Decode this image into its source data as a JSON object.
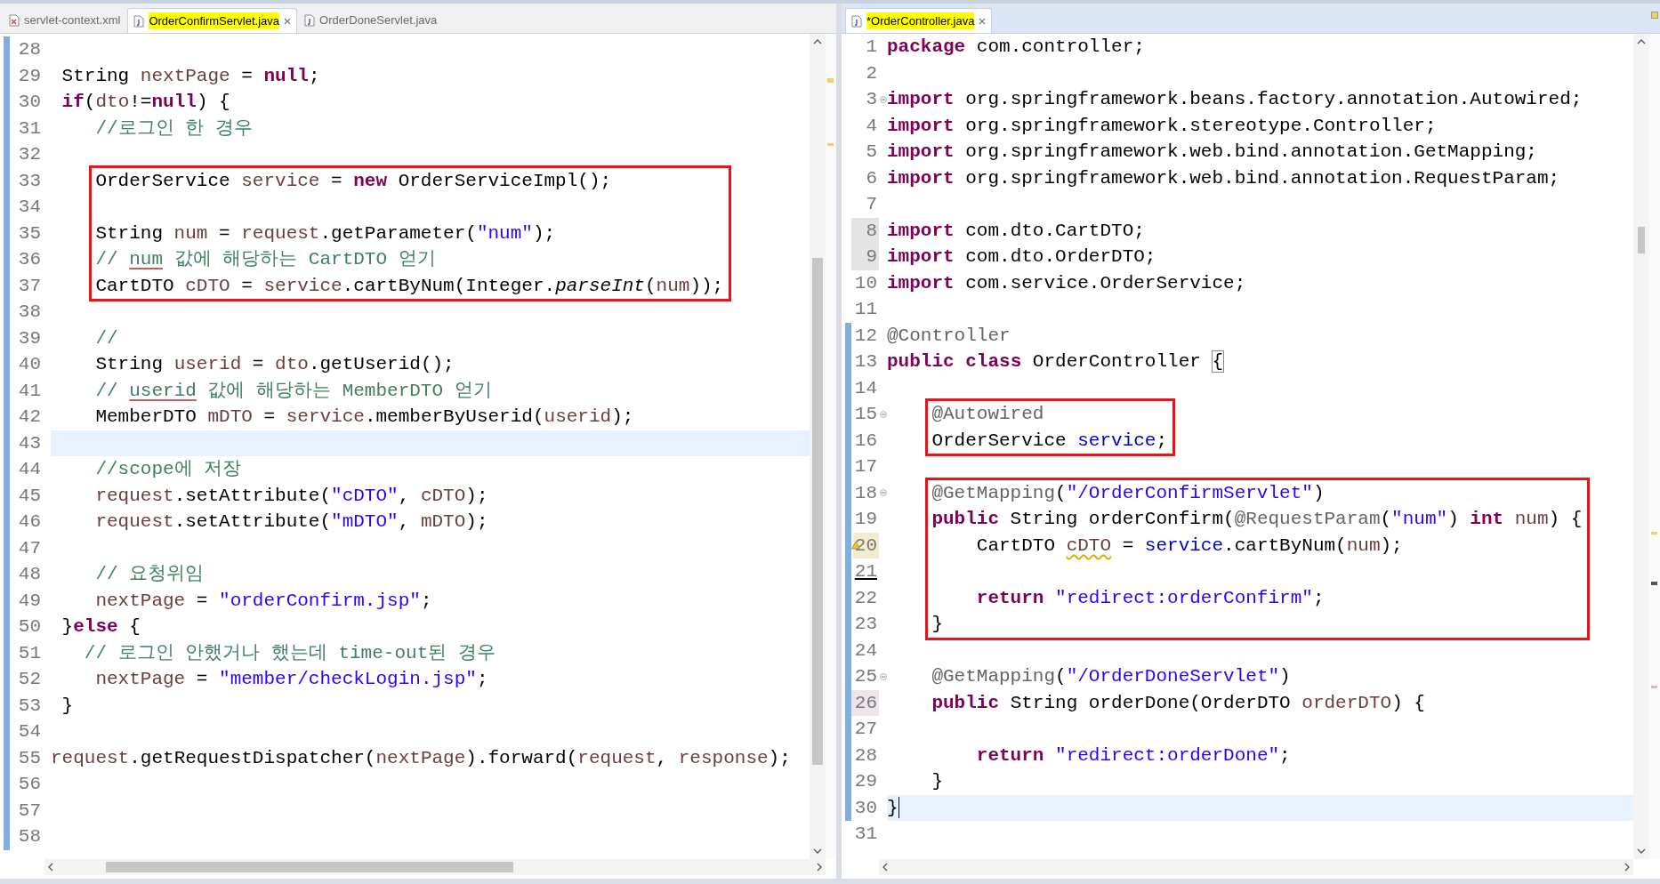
{
  "editors": [
    {
      "tabs": [
        {
          "label": "servlet-context.xml",
          "kind": "xml",
          "selected": false,
          "highlighted": false,
          "closable": false
        },
        {
          "label": "OrderConfirmServlet.java",
          "kind": "java",
          "selected": true,
          "highlighted": true,
          "closable": true
        },
        {
          "label": "OrderDoneServlet.java",
          "kind": "java",
          "selected": false,
          "highlighted": false,
          "closable": false
        }
      ],
      "lines": [
        {
          "n": "28",
          "current": false,
          "boxed": false,
          "diff": true
        },
        {
          "n": "29",
          "tokens": [
            {
              "kind": "plain",
              "text": " String "
            },
            {
              "kind": "local",
              "text": "nextPage"
            },
            {
              "kind": "plain",
              "text": " = "
            },
            {
              "kind": "keyword",
              "text": "null"
            },
            {
              "kind": "plain",
              "text": ";"
            }
          ],
          "current": false,
          "boxed": false,
          "diff": true
        },
        {
          "n": "30",
          "tokens": [
            {
              "kind": "keyword",
              "text": " if"
            },
            {
              "kind": "plain",
              "text": "("
            },
            {
              "kind": "local",
              "text": "dto"
            },
            {
              "kind": "plain",
              "text": "!="
            },
            {
              "kind": "keyword",
              "text": "null"
            },
            {
              "kind": "plain",
              "text": ") {"
            }
          ],
          "current": false,
          "boxed": false,
          "diff": true
        },
        {
          "n": "31",
          "tokens": [
            {
              "kind": "comment",
              "text": "    //로그인 한 경우"
            }
          ],
          "current": false,
          "boxed": false,
          "diff": true
        },
        {
          "n": "32",
          "current": false,
          "boxed": false,
          "diff": true
        },
        {
          "n": "33",
          "tokens": [
            {
              "kind": "plain",
              "text": "    OrderService "
            },
            {
              "kind": "local",
              "text": "service"
            },
            {
              "kind": "plain",
              "text": " = "
            },
            {
              "kind": "keyword",
              "text": "new"
            },
            {
              "kind": "plain",
              "text": " OrderServiceImpl();"
            }
          ],
          "current": false,
          "boxed": true,
          "diff": true
        },
        {
          "n": "34",
          "current": false,
          "boxed": true,
          "diff": true
        },
        {
          "n": "35",
          "tokens": [
            {
              "kind": "plain",
              "text": "    String "
            },
            {
              "kind": "local",
              "text": "num"
            },
            {
              "kind": "plain",
              "text": " = "
            },
            {
              "kind": "local",
              "text": "request"
            },
            {
              "kind": "plain",
              "text": ".getParameter("
            },
            {
              "kind": "string",
              "text": "\"num\""
            },
            {
              "kind": "plain",
              "text": ");"
            }
          ],
          "current": false,
          "boxed": true,
          "diff": true
        },
        {
          "n": "36",
          "tokens": [
            {
              "kind": "comment",
              "text": "    // "
            },
            {
              "kind": "spelling",
              "text": "num"
            },
            {
              "kind": "comment",
              "text": " 값에 해당하는 CartDTO 얻기"
            }
          ],
          "current": false,
          "boxed": true,
          "diff": true
        },
        {
          "n": "37",
          "tokens": [
            {
              "kind": "plain",
              "text": "    CartDTO "
            },
            {
              "kind": "local",
              "text": "cDTO"
            },
            {
              "kind": "plain",
              "text": " = "
            },
            {
              "kind": "local",
              "text": "service"
            },
            {
              "kind": "plain",
              "text": ".cartByNum(Integer."
            },
            {
              "kind": "italic",
              "text": "parseInt"
            },
            {
              "kind": "plain",
              "text": "("
            },
            {
              "kind": "local",
              "text": "num"
            },
            {
              "kind": "plain",
              "text": "));"
            }
          ],
          "current": false,
          "boxed": true,
          "diff": true
        },
        {
          "n": "38",
          "current": false,
          "boxed": false,
          "diff": true
        },
        {
          "n": "39",
          "tokens": [
            {
              "kind": "comment",
              "text": "    //"
            }
          ],
          "current": false,
          "boxed": false,
          "diff": true
        },
        {
          "n": "40",
          "tokens": [
            {
              "kind": "plain",
              "text": "    String "
            },
            {
              "kind": "local",
              "text": "userid"
            },
            {
              "kind": "plain",
              "text": " = "
            },
            {
              "kind": "local",
              "text": "dto"
            },
            {
              "kind": "plain",
              "text": ".getUserid();"
            }
          ],
          "current": false,
          "boxed": false,
          "diff": true
        },
        {
          "n": "41",
          "tokens": [
            {
              "kind": "comment",
              "text": "    // "
            },
            {
              "kind": "spelling",
              "text": "userid"
            },
            {
              "kind": "comment",
              "text": " 값에 해당하는 MemberDTO 얻기"
            }
          ],
          "current": false,
          "boxed": false,
          "diff": true
        },
        {
          "n": "42",
          "tokens": [
            {
              "kind": "plain",
              "text": "    MemberDTO "
            },
            {
              "kind": "local",
              "text": "mDTO"
            },
            {
              "kind": "plain",
              "text": " = "
            },
            {
              "kind": "local",
              "text": "service"
            },
            {
              "kind": "plain",
              "text": ".memberByUserid("
            },
            {
              "kind": "local",
              "text": "userid"
            },
            {
              "kind": "plain",
              "text": ");"
            }
          ],
          "current": false,
          "boxed": false,
          "diff": true
        },
        {
          "n": "43",
          "current": true,
          "boxed": false,
          "diff": true
        },
        {
          "n": "44",
          "tokens": [
            {
              "kind": "comment",
              "text": "    //scope에 저장"
            }
          ],
          "current": false,
          "boxed": false,
          "diff": true
        },
        {
          "n": "45",
          "tokens": [
            {
              "kind": "local",
              "text": "    request"
            },
            {
              "kind": "plain",
              "text": ".setAttribute("
            },
            {
              "kind": "string",
              "text": "\"cDTO\""
            },
            {
              "kind": "plain",
              "text": ", "
            },
            {
              "kind": "local",
              "text": "cDTO"
            },
            {
              "kind": "plain",
              "text": ");"
            }
          ],
          "current": false,
          "boxed": false,
          "diff": true
        },
        {
          "n": "46",
          "tokens": [
            {
              "kind": "local",
              "text": "    request"
            },
            {
              "kind": "plain",
              "text": ".setAttribute("
            },
            {
              "kind": "string",
              "text": "\"mDTO\""
            },
            {
              "kind": "plain",
              "text": ", "
            },
            {
              "kind": "local",
              "text": "mDTO"
            },
            {
              "kind": "plain",
              "text": ");"
            }
          ],
          "current": false,
          "boxed": false,
          "diff": true
        },
        {
          "n": "47",
          "current": false,
          "boxed": false,
          "diff": true
        },
        {
          "n": "48",
          "tokens": [
            {
              "kind": "comment",
              "text": "    // 요청위임"
            }
          ],
          "current": false,
          "boxed": false,
          "diff": true
        },
        {
          "n": "49",
          "tokens": [
            {
              "kind": "local",
              "text": "    nextPage"
            },
            {
              "kind": "plain",
              "text": " = "
            },
            {
              "kind": "string",
              "text": "\"orderConfirm.jsp\""
            },
            {
              "kind": "plain",
              "text": ";"
            }
          ],
          "current": false,
          "boxed": false,
          "diff": true
        },
        {
          "n": "50",
          "tokens": [
            {
              "kind": "plain",
              "text": " }"
            },
            {
              "kind": "keyword",
              "text": "else"
            },
            {
              "kind": "plain",
              "text": " {"
            }
          ],
          "current": false,
          "boxed": false,
          "diff": true
        },
        {
          "n": "51",
          "tokens": [
            {
              "kind": "comment",
              "text": "   // 로그인 안했거나 했는데 time-out된 경우"
            }
          ],
          "current": false,
          "boxed": false,
          "diff": true
        },
        {
          "n": "52",
          "tokens": [
            {
              "kind": "local",
              "text": "    nextPage"
            },
            {
              "kind": "plain",
              "text": " = "
            },
            {
              "kind": "string",
              "text": "\"member/checkLogin.jsp\""
            },
            {
              "kind": "plain",
              "text": ";"
            }
          ],
          "current": false,
          "boxed": false,
          "diff": true
        },
        {
          "n": "53",
          "tokens": [
            {
              "kind": "plain",
              "text": " }"
            }
          ],
          "current": false,
          "boxed": false,
          "diff": true
        },
        {
          "n": "54",
          "current": false,
          "boxed": false,
          "diff": true
        },
        {
          "n": "55",
          "tokens": [
            {
              "kind": "local",
              "text": "request"
            },
            {
              "kind": "plain",
              "text": ".getRequestDispatcher("
            },
            {
              "kind": "local",
              "text": "nextPage"
            },
            {
              "kind": "plain",
              "text": ").forward("
            },
            {
              "kind": "local",
              "text": "request"
            },
            {
              "kind": "plain",
              "text": ", "
            },
            {
              "kind": "local",
              "text": "response"
            },
            {
              "kind": "plain",
              "text": ");"
            }
          ],
          "current": false,
          "boxed": false,
          "diff": true
        },
        {
          "n": "56",
          "current": false,
          "boxed": false,
          "diff": true
        },
        {
          "n": "57",
          "current": false,
          "boxed": false,
          "diff": true
        },
        {
          "n": "58",
          "current": false,
          "boxed": false,
          "diff": true
        }
      ]
    },
    {
      "tabs": [
        {
          "label": "*OrderController.java",
          "kind": "java",
          "selected": true,
          "highlighted": true,
          "closable": true
        }
      ],
      "lines": [
        {
          "n": "1",
          "tokens": [
            {
              "kind": "keyword",
              "text": "package"
            },
            {
              "kind": "plain",
              "text": " com.controller;"
            }
          ],
          "current": false,
          "boxed": false,
          "diff": false
        },
        {
          "n": "2",
          "current": false,
          "boxed": false,
          "diff": false
        },
        {
          "n": "3",
          "tokens": [
            {
              "kind": "keyword",
              "text": "import"
            },
            {
              "kind": "plain",
              "text": " org.springframework.beans.factory.annotation.Autowired;"
            }
          ],
          "current": false,
          "boxed": false,
          "diff": false,
          "kind": "fold"
        },
        {
          "n": "4",
          "tokens": [
            {
              "kind": "keyword",
              "text": "import"
            },
            {
              "kind": "plain",
              "text": " org.springframework.stereotype.Controller;"
            }
          ],
          "current": false,
          "boxed": false,
          "diff": false
        },
        {
          "n": "5",
          "tokens": [
            {
              "kind": "keyword",
              "text": "import"
            },
            {
              "kind": "plain",
              "text": " org.springframework.web.bind.annotation.GetMapping;"
            }
          ],
          "current": false,
          "boxed": false,
          "diff": false
        },
        {
          "n": "6",
          "tokens": [
            {
              "kind": "keyword",
              "text": "import"
            },
            {
              "kind": "plain",
              "text": " org.springframework.web.bind.annotation.RequestParam;"
            }
          ],
          "current": false,
          "boxed": false,
          "diff": false
        },
        {
          "n": "7",
          "current": false,
          "boxed": false,
          "diff": false
        },
        {
          "n": "8",
          "tokens": [
            {
              "kind": "keyword",
              "text": "import"
            },
            {
              "kind": "plain",
              "text": " com.dto.CartDTO;"
            }
          ],
          "current": false,
          "boxed": false,
          "diff": false,
          "kind": "changed"
        },
        {
          "n": "9",
          "tokens": [
            {
              "kind": "keyword",
              "text": "import"
            },
            {
              "kind": "plain",
              "text": " com.dto.OrderDTO;"
            }
          ],
          "current": false,
          "boxed": false,
          "diff": false,
          "kind": "changed"
        },
        {
          "n": "10",
          "tokens": [
            {
              "kind": "keyword",
              "text": "import"
            },
            {
              "kind": "plain",
              "text": " com.service.OrderService;"
            }
          ],
          "current": false,
          "boxed": false,
          "diff": false
        },
        {
          "n": "11",
          "current": false,
          "boxed": false,
          "diff": false
        },
        {
          "n": "12",
          "tokens": [
            {
              "kind": "annotation",
              "text": "@Controller"
            }
          ],
          "current": false,
          "boxed": false,
          "diff": true
        },
        {
          "n": "13",
          "tokens": [
            {
              "kind": "keyword",
              "text": "public"
            },
            {
              "kind": "keyword",
              "text": " class"
            },
            {
              "kind": "plain",
              "text": " OrderController "
            },
            {
              "kind": "bracket",
              "text": "{"
            }
          ],
          "current": false,
          "boxed": false,
          "diff": true
        },
        {
          "n": "14",
          "current": false,
          "boxed": false,
          "diff": true
        },
        {
          "n": "15",
          "tokens": [
            {
              "kind": "annotation",
              "text": "    @Autowired"
            }
          ],
          "current": false,
          "boxed": true,
          "diff": true,
          "kind": "fold"
        },
        {
          "n": "16",
          "tokens": [
            {
              "kind": "plain",
              "text": "    OrderService "
            },
            {
              "kind": "field",
              "text": "service"
            },
            {
              "kind": "plain",
              "text": ";"
            }
          ],
          "current": false,
          "boxed": true,
          "diff": true
        },
        {
          "n": "17",
          "current": false,
          "boxed": false,
          "diff": true
        },
        {
          "n": "18",
          "tokens": [
            {
              "kind": "annotation",
              "text": "    @GetMapping"
            },
            {
              "kind": "plain",
              "text": "("
            },
            {
              "kind": "string",
              "text": "\"/OrderConfirmServlet\""
            },
            {
              "kind": "plain",
              "text": ")"
            }
          ],
          "current": false,
          "boxed": true,
          "diff": true,
          "kind": "fold"
        },
        {
          "n": "19",
          "tokens": [
            {
              "kind": "keyword",
              "text": "    public"
            },
            {
              "kind": "plain",
              "text": " String orderConfirm("
            },
            {
              "kind": "annotation",
              "text": "@RequestParam"
            },
            {
              "kind": "plain",
              "text": "("
            },
            {
              "kind": "string",
              "text": "\"num\""
            },
            {
              "kind": "plain",
              "text": ") "
            },
            {
              "kind": "keyword",
              "text": "int"
            },
            {
              "kind": "local",
              "text": " num"
            },
            {
              "kind": "plain",
              "text": ") {"
            }
          ],
          "current": false,
          "boxed": true,
          "diff": true
        },
        {
          "n": "20",
          "tokens": [
            {
              "kind": "plain",
              "text": "        CartDTO "
            },
            {
              "kind": "warning",
              "text": "cDTO"
            },
            {
              "kind": "plain",
              "text": " = "
            },
            {
              "kind": "field",
              "text": "service"
            },
            {
              "kind": "plain",
              "text": ".cartByNum("
            },
            {
              "kind": "local",
              "text": "num"
            },
            {
              "kind": "plain",
              "text": ");"
            }
          ],
          "current": false,
          "boxed": true,
          "diff": true,
          "kind": "warning"
        },
        {
          "n": "21",
          "current": false,
          "boxed": true,
          "diff": true,
          "kind": "underline"
        },
        {
          "n": "22",
          "tokens": [
            {
              "kind": "keyword",
              "text": "        return"
            },
            {
              "kind": "string",
              "text": " \"redirect:orderConfirm\""
            },
            {
              "kind": "plain",
              "text": ";"
            }
          ],
          "current": false,
          "boxed": true,
          "diff": true
        },
        {
          "n": "23",
          "tokens": [
            {
              "kind": "plain",
              "text": "    }"
            }
          ],
          "current": false,
          "boxed": true,
          "diff": true
        },
        {
          "n": "24",
          "current": false,
          "boxed": false,
          "diff": true
        },
        {
          "n": "25",
          "tokens": [
            {
              "kind": "annotation",
              "text": "    @GetMapping"
            },
            {
              "kind": "plain",
              "text": "("
            },
            {
              "kind": "string",
              "text": "\"/OrderDoneServlet\""
            },
            {
              "kind": "plain",
              "text": ")"
            }
          ],
          "current": false,
          "boxed": false,
          "diff": true,
          "kind": "fold"
        },
        {
          "n": "26",
          "tokens": [
            {
              "kind": "keyword",
              "text": "    public"
            },
            {
              "kind": "plain",
              "text": " String orderDone(OrderDTO "
            },
            {
              "kind": "local",
              "text": "orderDTO"
            },
            {
              "kind": "plain",
              "text": ") {"
            }
          ],
          "current": false,
          "boxed": false,
          "diff": true,
          "kind": "occurrence"
        },
        {
          "n": "27",
          "current": false,
          "boxed": false,
          "diff": true
        },
        {
          "n": "28",
          "tokens": [
            {
              "kind": "keyword",
              "text": "        return"
            },
            {
              "kind": "string",
              "text": " \"redirect:orderDone\""
            },
            {
              "kind": "plain",
              "text": ";"
            }
          ],
          "current": false,
          "boxed": false,
          "diff": true
        },
        {
          "n": "29",
          "tokens": [
            {
              "kind": "plain",
              "text": "    }"
            }
          ],
          "current": false,
          "boxed": false,
          "diff": true
        },
        {
          "n": "30",
          "tokens": [
            {
              "kind": "plain",
              "text": "}"
            }
          ],
          "current": true,
          "boxed": false,
          "diff": true
        },
        {
          "n": "31",
          "current": false,
          "boxed": false,
          "diff": false
        }
      ]
    }
  ]
}
